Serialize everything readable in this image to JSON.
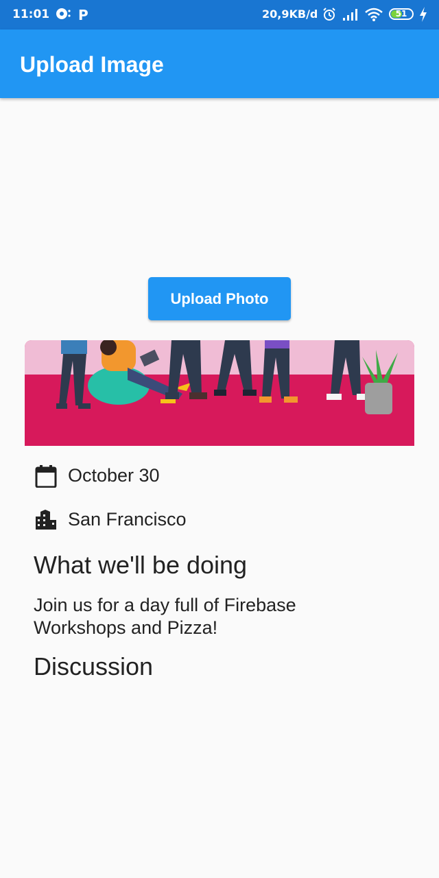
{
  "status_bar": {
    "time": "11:01",
    "network_speed": "20,9KB/d",
    "battery_level": "51",
    "carrier_badge": "P",
    "icons": [
      "notification-icon",
      "alarm-icon",
      "signal-icon",
      "wifi-icon",
      "battery-icon",
      "charging-icon"
    ]
  },
  "app_bar": {
    "title": "Upload Image",
    "background": "#2196f3"
  },
  "upload_button": {
    "label": "Upload Photo",
    "color": "#2196f3"
  },
  "event": {
    "date": "October 30",
    "date_icon": "calendar-icon",
    "location": "San Francisco",
    "location_icon": "location-city-icon",
    "section_title": "What we'll be doing",
    "description": "Join us for a day full of Firebase Workshops and Pizza!",
    "discussion_title": "Discussion"
  }
}
